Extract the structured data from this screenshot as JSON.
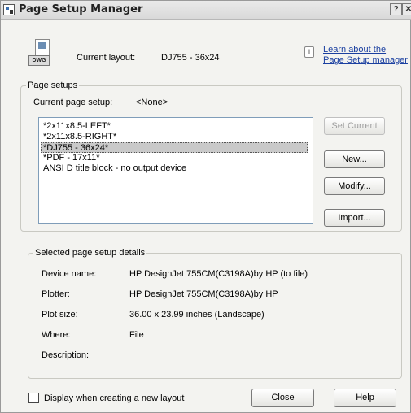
{
  "window": {
    "title": "Page Setup Manager",
    "help_glyph": "?",
    "close_glyph": "✕"
  },
  "header": {
    "file_icon_text": "DWG",
    "current_layout_label": "Current layout:",
    "current_layout_value": "DJ755 - 36x24",
    "learn_link_line1": "Learn about the",
    "learn_link_line2": "Page Setup manager"
  },
  "page_setups": {
    "legend": "Page setups",
    "current_label": "Current page setup:",
    "current_value": "<None>",
    "items": [
      "*2x11x8.5-LEFT*",
      "*2x11x8.5-RIGHT*",
      "*DJ755 - 36x24*",
      "*PDF - 17x11*",
      "ANSI D title block - no output device"
    ],
    "selected_index": 2,
    "buttons": {
      "set_current": "Set Current",
      "new": "New...",
      "modify": "Modify...",
      "import": "Import..."
    }
  },
  "details": {
    "legend": "Selected page setup details",
    "device_name_label": "Device name:",
    "device_name_value": "HP DesignJet 755CM(C3198A)by HP (to file)",
    "plotter_label": "Plotter:",
    "plotter_value": "HP DesignJet 755CM(C3198A)by HP",
    "plot_size_label": "Plot size:",
    "plot_size_value": "36.00 x 23.99 inches (Landscape)",
    "where_label": "Where:",
    "where_value": "File",
    "description_label": "Description:",
    "description_value": ""
  },
  "footer": {
    "checkbox_label": "Display when creating a new layout",
    "checkbox_checked": false,
    "close_label": "Close",
    "help_label": "Help"
  }
}
